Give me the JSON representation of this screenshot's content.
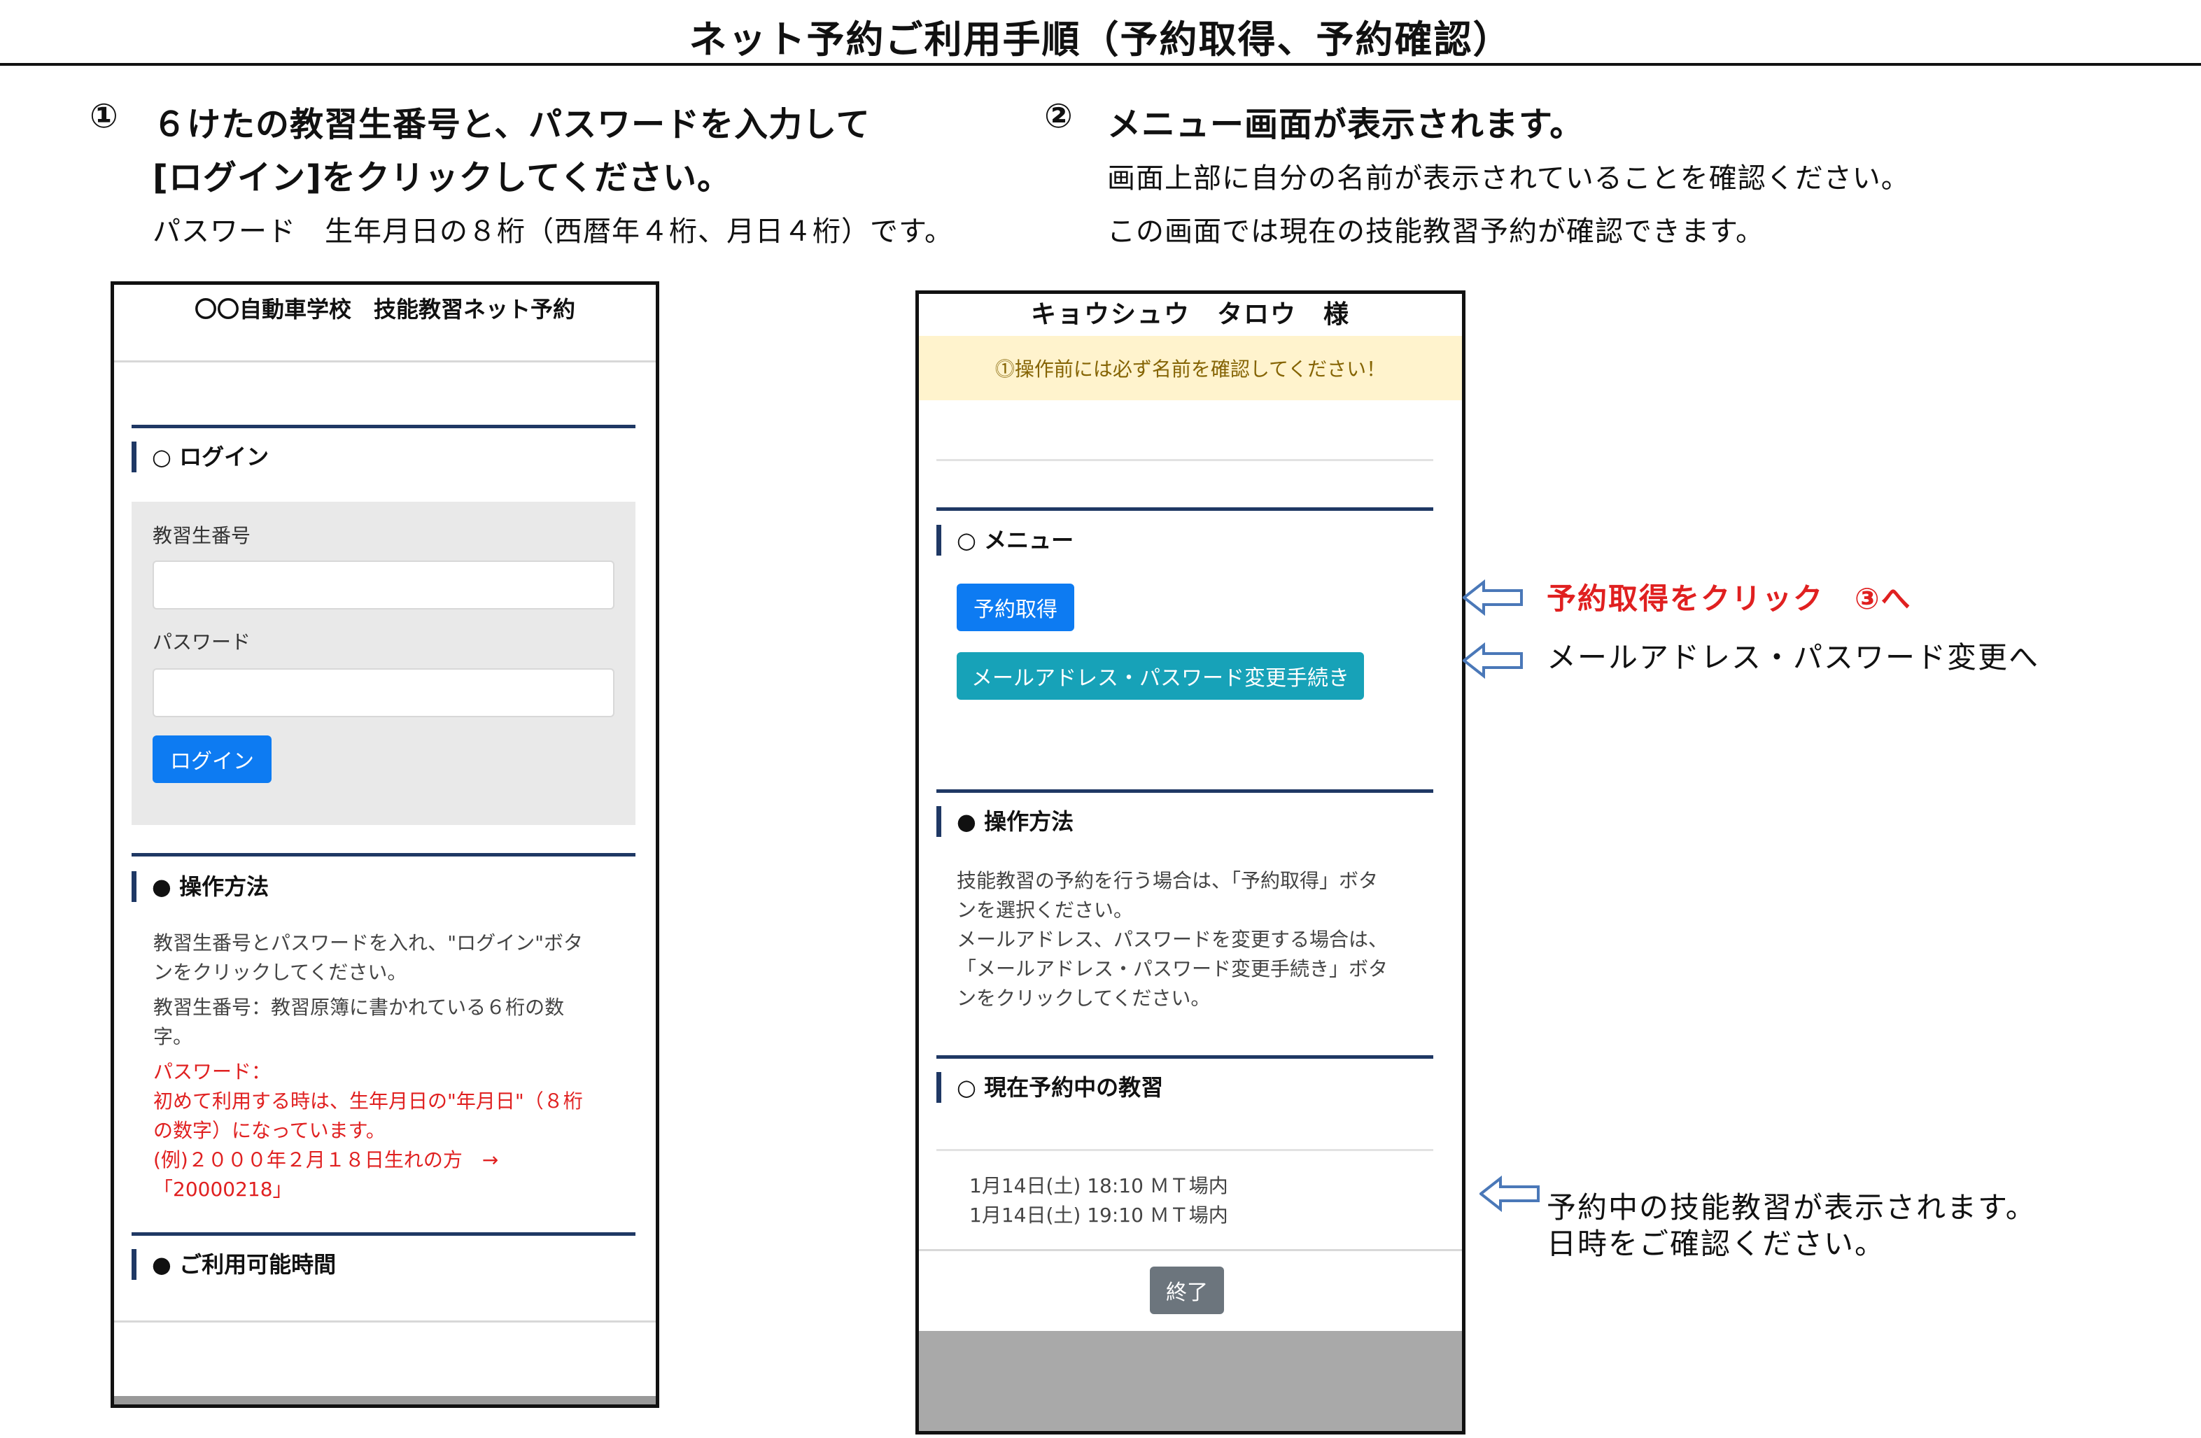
{
  "page": {
    "title": "ネット予約ご利用手順（予約取得、予約確認）"
  },
  "step1": {
    "num": "①",
    "line1": "６けたの教習生番号と、パスワードを入力して",
    "line2": "[ログイン]をクリックしてください。",
    "line3": "パスワード　生年月日の８桁（西暦年４桁、月日４桁）です。"
  },
  "step2": {
    "num": "②",
    "line1": "メニュー画面が表示されます。",
    "line2": "画面上部に自分の名前が表示されていることを確認ください。",
    "line3": "この画面では現在の技能教習予約が確認できます。"
  },
  "login_screen": {
    "header": "〇〇自動車学校　技能教習ネット予約",
    "login_section": "○ ログイン",
    "student_no_label": "教習生番号",
    "student_no_value": "",
    "password_label": "パスワード",
    "password_value": "",
    "login_button": "ログイン",
    "howto_title": "● 操作方法",
    "howto_p1_a": "教習生番号とパスワードを入れ、\"ログイン\"ボタ",
    "howto_p1_b": "ンをクリックしてください。",
    "howto_p2_a": "教習生番号：教習原簿に書かれている６桁の数",
    "howto_p2_b": "字。",
    "pw_note_a": "パスワード：",
    "pw_note_b": "初めて利用する時は、生年月日の\"年月日\"（８桁",
    "pw_note_c": "の数字）になっています。",
    "pw_note_d": "(例)２０００年２月１８日生れの方　→",
    "pw_note_e": "「20000218」",
    "hours_title": "● ご利用可能時間"
  },
  "menu_screen": {
    "user_name": "キョウシュウ　タロウ　様",
    "warning": "⓵操作前には必ず名前を確認してください！",
    "menu_section": "○ メニュー",
    "reserve_button": "予約取得",
    "change_button": "メールアドレス・パスワード変更手続き",
    "howto_title": "● 操作方法",
    "howto_a": "技能教習の予約を行う場合は、「予約取得」ボタ",
    "howto_b": "ンを選択ください。",
    "howto_c": "メールアドレス、パスワードを変更する場合は、",
    "howto_d": "「メールアドレス・パスワード変更手続き」ボタ",
    "howto_e": "ンをクリックしてください。",
    "current_title": "○ 現在予約中の教習",
    "reservations": [
      "1月14日(土) 18:10 ＭＴ場内",
      "1月14日(土) 19:10 ＭＴ場内"
    ],
    "end_button": "終了"
  },
  "annotations": {
    "reserve_note": "予約取得をクリック　③へ",
    "change_note": "メールアドレス・パスワード変更へ",
    "reserved_note_1": "予約中の技能教習が表示されます。",
    "reserved_note_2": "日時をご確認ください。"
  },
  "colors": {
    "primary_button": "#0d7bf2",
    "info_button": "#17a2b8",
    "secondary_button": "#6c757d",
    "section_rule": "#1f3864",
    "warning_bg": "#fff3cd",
    "warning_text": "#856404",
    "annotation_red": "#e02020",
    "arrow_blue": "#4a78b8"
  }
}
